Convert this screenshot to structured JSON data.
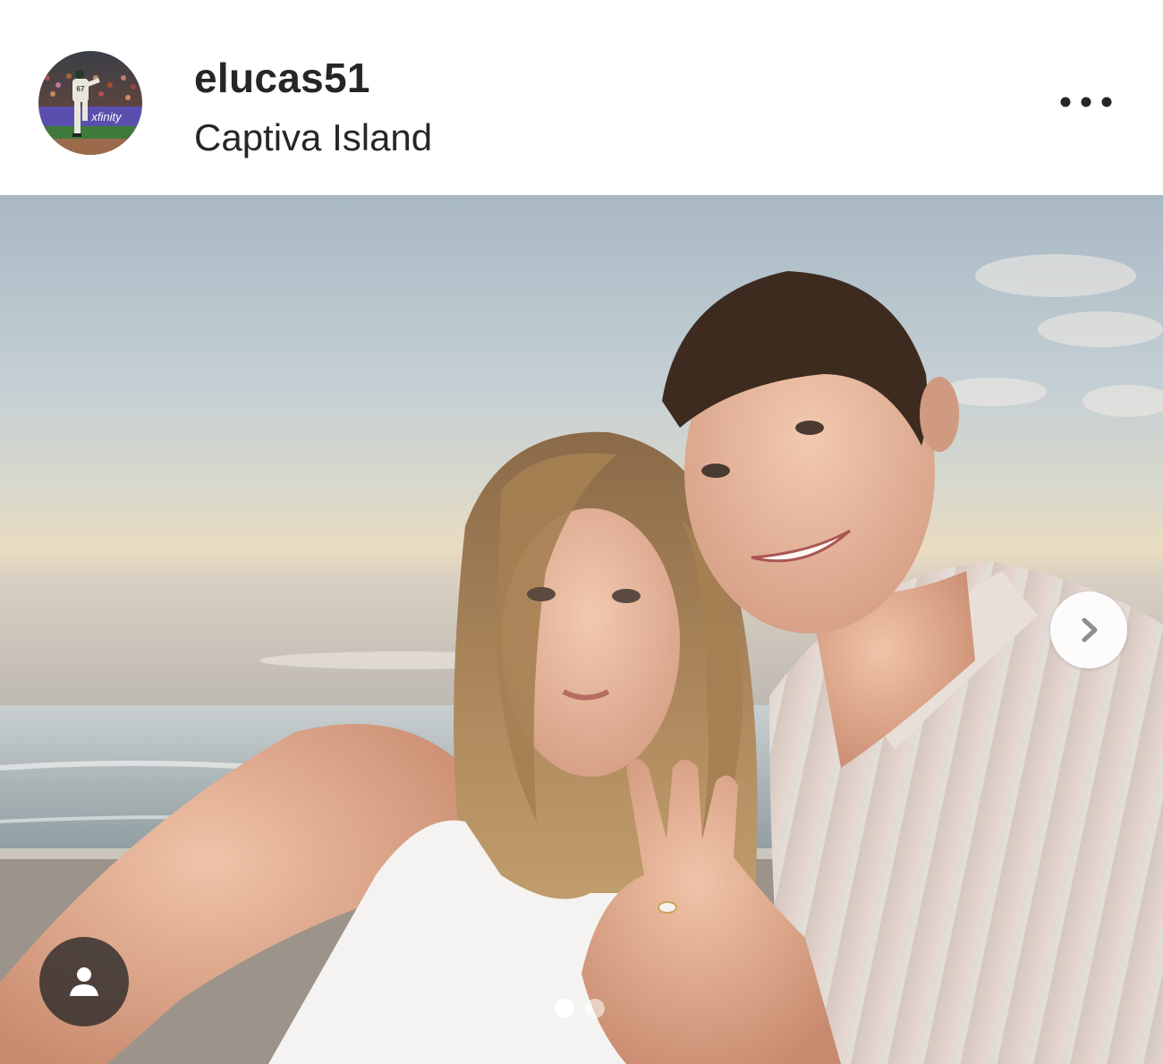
{
  "post": {
    "username": "elucas51",
    "location": "Captiva Island"
  },
  "avatar": {
    "banner_text": "xfinity",
    "jersey_number": "67"
  },
  "carousel": {
    "slide_count": 2,
    "active_index": 0
  },
  "icons": {
    "more": "more-horizontal-icon",
    "next": "chevron-right-icon",
    "tag": "user-tag-icon"
  },
  "colors": {
    "text": "#262626",
    "overlay_button": "#262626",
    "dot_active": "#ffffff"
  }
}
